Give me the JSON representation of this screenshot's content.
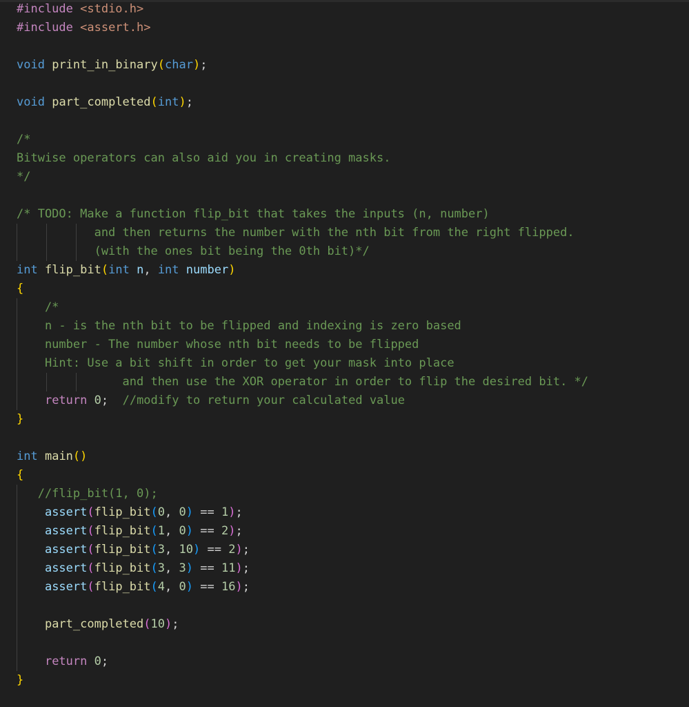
{
  "colors": {
    "background": "#1f1f1f",
    "preprocessor": "#c586c0",
    "include_path": "#ce9178",
    "keyword": "#569cd6",
    "function": "#dcdcaa",
    "variable": "#9cdcfe",
    "number": "#b5cea8",
    "comment": "#6a9955",
    "bracket_level1": "#ffd700",
    "bracket_level2": "#da70d6",
    "bracket_level3": "#179fff",
    "control": "#c586c0",
    "indent_guide": "#404040"
  },
  "lines": [
    {
      "guides": 0,
      "tokens": [
        {
          "t": "#include ",
          "c": "pre"
        },
        {
          "t": "<stdio.h>",
          "c": "str"
        }
      ]
    },
    {
      "guides": 0,
      "tokens": [
        {
          "t": "#include ",
          "c": "pre"
        },
        {
          "t": "<assert.h>",
          "c": "str"
        }
      ]
    },
    {
      "guides": 0,
      "tokens": []
    },
    {
      "guides": 0,
      "tokens": [
        {
          "t": "void",
          "c": "kw"
        },
        {
          "t": " ",
          "c": "plain"
        },
        {
          "t": "print_in_binary",
          "c": "fn"
        },
        {
          "t": "(",
          "c": "br1"
        },
        {
          "t": "char",
          "c": "kw"
        },
        {
          "t": ")",
          "c": "br1"
        },
        {
          "t": ";",
          "c": "plain"
        }
      ]
    },
    {
      "guides": 0,
      "tokens": []
    },
    {
      "guides": 0,
      "tokens": [
        {
          "t": "void",
          "c": "kw"
        },
        {
          "t": " ",
          "c": "plain"
        },
        {
          "t": "part_completed",
          "c": "fn"
        },
        {
          "t": "(",
          "c": "br1"
        },
        {
          "t": "int",
          "c": "kw"
        },
        {
          "t": ")",
          "c": "br1"
        },
        {
          "t": ";",
          "c": "plain"
        }
      ]
    },
    {
      "guides": 0,
      "tokens": []
    },
    {
      "guides": 0,
      "tokens": [
        {
          "t": "/*",
          "c": "com"
        }
      ]
    },
    {
      "guides": 0,
      "tokens": [
        {
          "t": "Bitwise operators can also aid you in creating masks.",
          "c": "com"
        }
      ]
    },
    {
      "guides": 0,
      "tokens": [
        {
          "t": "*/",
          "c": "com"
        }
      ]
    },
    {
      "guides": 0,
      "tokens": []
    },
    {
      "guides": 0,
      "tokens": [
        {
          "t": "/* TODO: Make a function flip_bit that takes the inputs (n, number)",
          "c": "com"
        }
      ]
    },
    {
      "guides": 3,
      "tokens": [
        {
          "t": "           and then returns the number with the nth bit from the right flipped.",
          "c": "com"
        }
      ]
    },
    {
      "guides": 3,
      "tokens": [
        {
          "t": "           (with the ones bit being the 0th bit)*/",
          "c": "com"
        }
      ]
    },
    {
      "guides": 0,
      "tokens": [
        {
          "t": "int",
          "c": "kw"
        },
        {
          "t": " ",
          "c": "plain"
        },
        {
          "t": "flip_bit",
          "c": "fn"
        },
        {
          "t": "(",
          "c": "br1"
        },
        {
          "t": "int",
          "c": "kw"
        },
        {
          "t": " ",
          "c": "plain"
        },
        {
          "t": "n",
          "c": "var"
        },
        {
          "t": ", ",
          "c": "plain"
        },
        {
          "t": "int",
          "c": "kw"
        },
        {
          "t": " ",
          "c": "plain"
        },
        {
          "t": "number",
          "c": "var"
        },
        {
          "t": ")",
          "c": "br1"
        }
      ]
    },
    {
      "guides": 0,
      "tokens": [
        {
          "t": "{",
          "c": "br1"
        }
      ]
    },
    {
      "guides": 1,
      "tokens": [
        {
          "t": "    /*",
          "c": "com"
        }
      ]
    },
    {
      "guides": 1,
      "tokens": [
        {
          "t": "    n - is the nth bit to be flipped and indexing is zero based",
          "c": "com"
        }
      ]
    },
    {
      "guides": 1,
      "tokens": [
        {
          "t": "    number - The number whose nth bit needs to be flipped",
          "c": "com"
        }
      ]
    },
    {
      "guides": 1,
      "tokens": [
        {
          "t": "    Hint: Use a bit shift in order to get your mask into place",
          "c": "com"
        }
      ]
    },
    {
      "guides": 3,
      "tokens": [
        {
          "t": "               and then use the XOR operator in order to flip the desired bit. */",
          "c": "com"
        }
      ]
    },
    {
      "guides": 1,
      "tokens": [
        {
          "t": "    ",
          "c": "plain"
        },
        {
          "t": "return",
          "c": "ctrl"
        },
        {
          "t": " ",
          "c": "plain"
        },
        {
          "t": "0",
          "c": "num"
        },
        {
          "t": ";  ",
          "c": "plain"
        },
        {
          "t": "//modify to return your calculated value",
          "c": "com"
        }
      ]
    },
    {
      "guides": 0,
      "tokens": [
        {
          "t": "}",
          "c": "br1"
        }
      ]
    },
    {
      "guides": 0,
      "tokens": []
    },
    {
      "guides": 0,
      "tokens": [
        {
          "t": "int",
          "c": "kw"
        },
        {
          "t": " ",
          "c": "plain"
        },
        {
          "t": "main",
          "c": "fn"
        },
        {
          "t": "()",
          "c": "br1"
        }
      ]
    },
    {
      "guides": 0,
      "tokens": [
        {
          "t": "{",
          "c": "br1"
        }
      ]
    },
    {
      "guides": 1,
      "tokens": [
        {
          "t": "   //flip_bit(1, 0);",
          "c": "com"
        }
      ]
    },
    {
      "guides": 1,
      "tokens": [
        {
          "t": "    ",
          "c": "plain"
        },
        {
          "t": "assert",
          "c": "var"
        },
        {
          "t": "(",
          "c": "br2"
        },
        {
          "t": "flip_bit",
          "c": "fn"
        },
        {
          "t": "(",
          "c": "br3"
        },
        {
          "t": "0",
          "c": "num"
        },
        {
          "t": ", ",
          "c": "plain"
        },
        {
          "t": "0",
          "c": "num"
        },
        {
          "t": ")",
          "c": "br3"
        },
        {
          "t": " == ",
          "c": "plain"
        },
        {
          "t": "1",
          "c": "num"
        },
        {
          "t": ")",
          "c": "br2"
        },
        {
          "t": ";",
          "c": "plain"
        }
      ]
    },
    {
      "guides": 1,
      "tokens": [
        {
          "t": "    ",
          "c": "plain"
        },
        {
          "t": "assert",
          "c": "var"
        },
        {
          "t": "(",
          "c": "br2"
        },
        {
          "t": "flip_bit",
          "c": "fn"
        },
        {
          "t": "(",
          "c": "br3"
        },
        {
          "t": "1",
          "c": "num"
        },
        {
          "t": ", ",
          "c": "plain"
        },
        {
          "t": "0",
          "c": "num"
        },
        {
          "t": ")",
          "c": "br3"
        },
        {
          "t": " == ",
          "c": "plain"
        },
        {
          "t": "2",
          "c": "num"
        },
        {
          "t": ")",
          "c": "br2"
        },
        {
          "t": ";",
          "c": "plain"
        }
      ]
    },
    {
      "guides": 1,
      "tokens": [
        {
          "t": "    ",
          "c": "plain"
        },
        {
          "t": "assert",
          "c": "var"
        },
        {
          "t": "(",
          "c": "br2"
        },
        {
          "t": "flip_bit",
          "c": "fn"
        },
        {
          "t": "(",
          "c": "br3"
        },
        {
          "t": "3",
          "c": "num"
        },
        {
          "t": ", ",
          "c": "plain"
        },
        {
          "t": "10",
          "c": "num"
        },
        {
          "t": ")",
          "c": "br3"
        },
        {
          "t": " == ",
          "c": "plain"
        },
        {
          "t": "2",
          "c": "num"
        },
        {
          "t": ")",
          "c": "br2"
        },
        {
          "t": ";",
          "c": "plain"
        }
      ]
    },
    {
      "guides": 1,
      "tokens": [
        {
          "t": "    ",
          "c": "plain"
        },
        {
          "t": "assert",
          "c": "var"
        },
        {
          "t": "(",
          "c": "br2"
        },
        {
          "t": "flip_bit",
          "c": "fn"
        },
        {
          "t": "(",
          "c": "br3"
        },
        {
          "t": "3",
          "c": "num"
        },
        {
          "t": ", ",
          "c": "plain"
        },
        {
          "t": "3",
          "c": "num"
        },
        {
          "t": ")",
          "c": "br3"
        },
        {
          "t": " == ",
          "c": "plain"
        },
        {
          "t": "11",
          "c": "num"
        },
        {
          "t": ")",
          "c": "br2"
        },
        {
          "t": ";",
          "c": "plain"
        }
      ]
    },
    {
      "guides": 1,
      "tokens": [
        {
          "t": "    ",
          "c": "plain"
        },
        {
          "t": "assert",
          "c": "var"
        },
        {
          "t": "(",
          "c": "br2"
        },
        {
          "t": "flip_bit",
          "c": "fn"
        },
        {
          "t": "(",
          "c": "br3"
        },
        {
          "t": "4",
          "c": "num"
        },
        {
          "t": ", ",
          "c": "plain"
        },
        {
          "t": "0",
          "c": "num"
        },
        {
          "t": ")",
          "c": "br3"
        },
        {
          "t": " == ",
          "c": "plain"
        },
        {
          "t": "16",
          "c": "num"
        },
        {
          "t": ")",
          "c": "br2"
        },
        {
          "t": ";",
          "c": "plain"
        }
      ]
    },
    {
      "guides": 1,
      "tokens": []
    },
    {
      "guides": 1,
      "tokens": [
        {
          "t": "    ",
          "c": "plain"
        },
        {
          "t": "part_completed",
          "c": "fn"
        },
        {
          "t": "(",
          "c": "br2"
        },
        {
          "t": "10",
          "c": "num"
        },
        {
          "t": ")",
          "c": "br2"
        },
        {
          "t": ";",
          "c": "plain"
        }
      ]
    },
    {
      "guides": 1,
      "tokens": []
    },
    {
      "guides": 1,
      "tokens": [
        {
          "t": "    ",
          "c": "plain"
        },
        {
          "t": "return",
          "c": "ctrl"
        },
        {
          "t": " ",
          "c": "plain"
        },
        {
          "t": "0",
          "c": "num"
        },
        {
          "t": ";",
          "c": "plain"
        }
      ]
    },
    {
      "guides": 0,
      "tokens": [
        {
          "t": "}",
          "c": "br1"
        }
      ]
    }
  ]
}
